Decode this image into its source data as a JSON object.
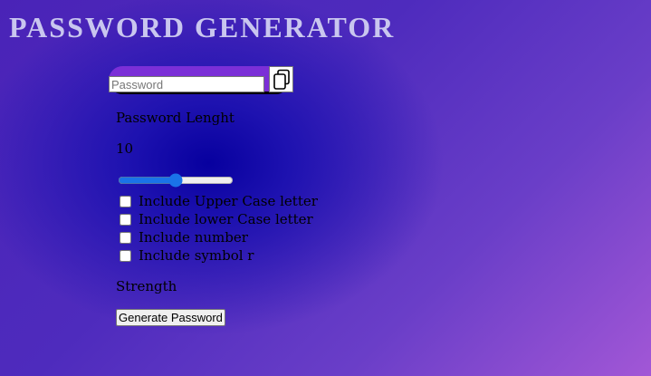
{
  "title": "PASSWORD GENERATOR",
  "password": {
    "placeholder": "Password",
    "value": ""
  },
  "copy_button": {
    "icon": "copy-icon"
  },
  "length": {
    "label": "Password Lenght",
    "value": "10",
    "slider_fraction": 0.5
  },
  "options": [
    {
      "label": "Include Upper Case letter",
      "checked": false
    },
    {
      "label": "Include lower Case letter",
      "checked": false
    },
    {
      "label": "Include number",
      "checked": false
    },
    {
      "label": "Include symbol r",
      "checked": false
    }
  ],
  "strength": {
    "label": "Strength"
  },
  "generate_button": {
    "label": "Generate Password"
  },
  "colors": {
    "accent": "#7b2fd7",
    "title": "#c9c6ef",
    "slider": "#1a73e8"
  }
}
